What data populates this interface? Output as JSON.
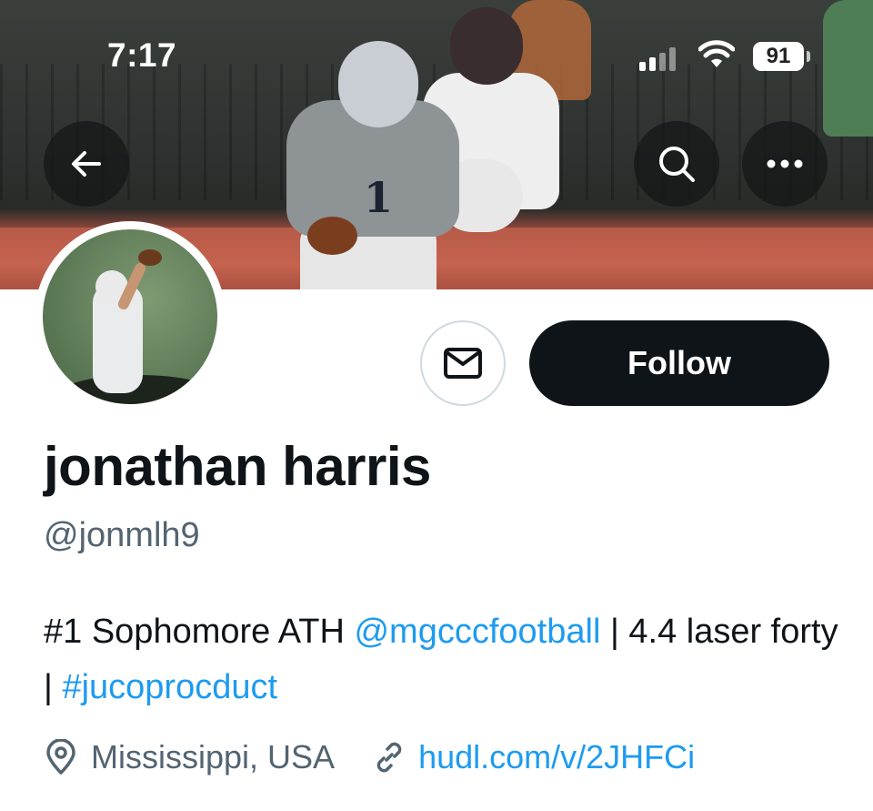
{
  "status_bar": {
    "time": "7:17",
    "battery": "91"
  },
  "banner": {
    "jersey_number": "1"
  },
  "nav": {
    "back_icon": "arrow-left-icon",
    "search_icon": "search-icon",
    "more_icon": "more-horizontal-icon"
  },
  "actions": {
    "message_icon": "envelope-icon",
    "follow_label": "Follow"
  },
  "profile": {
    "name": "jonathan harris",
    "handle": "@jonmlh9",
    "bio": {
      "part1": "#1 Sophomore ATH ",
      "mention": "@mgcccfootball",
      "part2": " | 4.4 laser forty | ",
      "hashtag": "#jucoprocduct"
    },
    "location": "Mississippi, USA",
    "website": "hudl.com/v/2JHFCi"
  },
  "colors": {
    "link": "#1d9bf0",
    "text": "#0f1419",
    "secondary": "#536471",
    "follow_bg": "#0f1419"
  }
}
